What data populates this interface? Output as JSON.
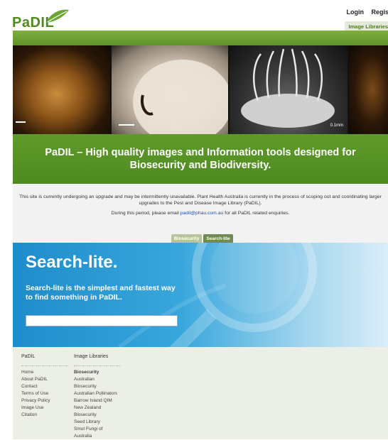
{
  "logo": {
    "text": "PaDIL"
  },
  "topnav": {
    "login": "Login",
    "register": "Regist",
    "active_tab": "Image Libraries"
  },
  "gallery": {
    "scale_label": "0.1mm"
  },
  "banner": {
    "title": "PaDIL – High quality images and Information tools designed for Biosecurity and Biodiversity."
  },
  "notice": {
    "line1": "This site is currently undergoing an upgrade and may be intermittently unavailable. Plant Health Australia is currently in the process of scoping out and coordinating larger upgrades to the Pest and Disease Image Library (PaDIL).",
    "line2_prefix": "During this period, please email ",
    "email": "padil@phau.com.au",
    "line2_suffix": " for all PaDIL related enquiries."
  },
  "subtabs": {
    "biosecurity": "Biosecurity",
    "search_lite": "Search-lite"
  },
  "search": {
    "title": "Search-lite.",
    "description": "Search-lite is the simplest and fastest way to find something in PaDIL.",
    "input_value": ""
  },
  "footer": {
    "col1": {
      "heading": "PaDIL",
      "items": [
        "Home",
        "About PaDIL",
        "Contact",
        "Terms of Use",
        "Privacy Policy",
        "Image Use",
        "Citation"
      ]
    },
    "col2": {
      "heading": "Image Libraries",
      "items": [
        "Biosecurity",
        "Australian",
        "Biosecurity",
        "Australian Pollinators",
        "Barrow Island QIM",
        "New Zealand",
        "Biosecurity",
        "Seed Library",
        "Smut Fungi of",
        "Australia"
      ]
    }
  },
  "colors": {
    "brand_green": "#5e9229",
    "search_blue": "#1d8ccb",
    "link_blue": "#1e4fb8"
  }
}
